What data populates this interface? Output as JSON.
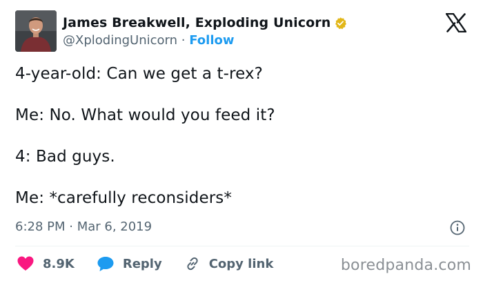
{
  "author": {
    "display_name": "James Breakwell, Exploding Unicorn",
    "handle": "@XplodingUnicorn",
    "separator": "·",
    "follow_label": "Follow",
    "verified_icon": "verified-badge-gold-icon"
  },
  "brand_icon": "x-logo-icon",
  "tweet": {
    "lines": [
      "4-year-old: Can we get a t-rex?",
      "Me: No. What would you feed it?",
      "4: Bad guys.",
      "Me: *carefully reconsiders*"
    ],
    "timestamp": "6:28 PM · Mar 6, 2019"
  },
  "actions": {
    "likes": "8.9K",
    "reply_label": "Reply",
    "copy_link_label": "Copy link"
  },
  "watermark": "boredpanda.com",
  "colors": {
    "text": "#0f1419",
    "secondary": "#536471",
    "accent": "#1d9bf0",
    "like": "#f91880",
    "reply": "#1d9bf0",
    "verified": "#e2b719"
  }
}
